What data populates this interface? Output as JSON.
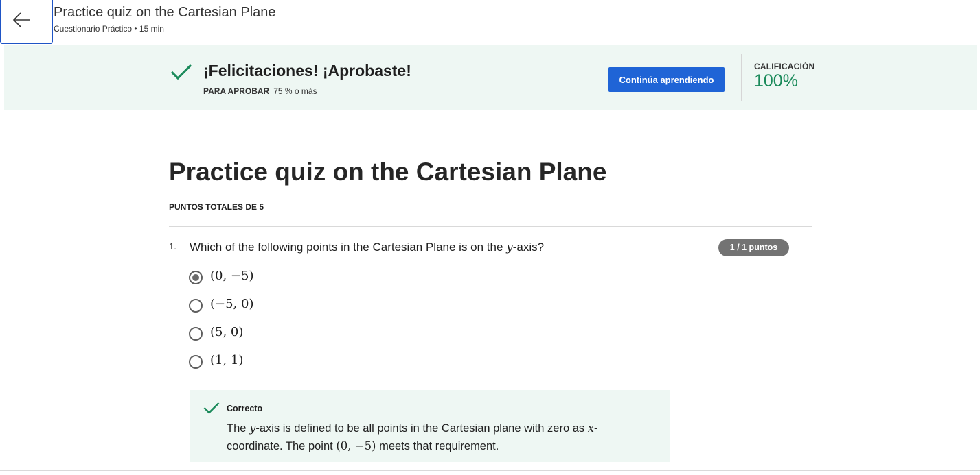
{
  "header": {
    "back_icon": "arrow-left-icon",
    "title": "Practice quiz on the Cartesian Plane",
    "subtitle": "Cuestionario Práctico • 15 min"
  },
  "banner": {
    "check_icon": "checkmark-icon",
    "message": "¡Felicitaciones! ¡Aprobaste!",
    "pass_label": "PARA APROBAR",
    "pass_value": "75 % o más",
    "continue_label": "Continúa aprendiendo",
    "grade_label": "CALIFICACIÓN",
    "grade_value": "100%",
    "colors": {
      "banner_bg": "#eef7f3",
      "accent": "#1f64d6",
      "success": "#1a8a5a"
    }
  },
  "quiz": {
    "title": "Practice quiz on the Cartesian Plane",
    "total_points": "PUNTOS TOTALES DE 5"
  },
  "question": {
    "number": "1.",
    "text_before": "Which of the following points in the Cartesian Plane is on the ",
    "text_var": "y",
    "text_after": "-axis?",
    "points": "1 / 1 puntos",
    "options": [
      {
        "label": "(0, −5)",
        "selected": true
      },
      {
        "label": "(−5, 0)",
        "selected": false
      },
      {
        "label": "(5, 0)",
        "selected": false
      },
      {
        "label": "(1, 1)",
        "selected": false
      }
    ]
  },
  "feedback": {
    "status": "Correcto",
    "icon": "checkmark-icon",
    "t1": "The ",
    "v1": "y",
    "t2": "-axis is defined to be all points in the Cartesian plane with zero as ",
    "v2": "x",
    "t3": "-coordinate. The point ",
    "v3": "(0, −5)",
    "t4": " meets that requirement."
  }
}
